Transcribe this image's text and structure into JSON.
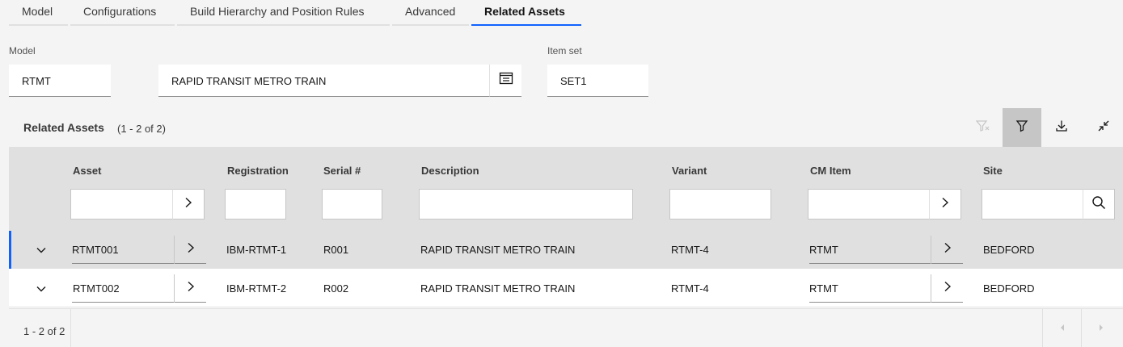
{
  "tabs": [
    {
      "label": "Model"
    },
    {
      "label": "Configurations"
    },
    {
      "label": "Build Hierarchy and Position Rules"
    },
    {
      "label": "Advanced"
    },
    {
      "label": "Related Assets"
    }
  ],
  "active_tab": "Related Assets",
  "form": {
    "model_label": "Model",
    "model_value": "RTMT",
    "model_description": "RAPID TRANSIT METRO TRAIN",
    "itemset_label": "Item set",
    "itemset_value": "SET1"
  },
  "table": {
    "title": "Related Assets",
    "count": "(1 - 2 of 2)",
    "columns": [
      "Asset",
      "Registration",
      "Serial #",
      "Description",
      "Variant",
      "CM Item",
      "Site"
    ],
    "rows": [
      {
        "asset": "RTMT001",
        "registration": "IBM-RTMT-1",
        "serial": "R001",
        "description": "RAPID TRANSIT METRO TRAIN",
        "variant": "RTMT-4",
        "cm_item": "RTMT",
        "site": "BEDFORD",
        "selected": true
      },
      {
        "asset": "RTMT002",
        "registration": "IBM-RTMT-2",
        "serial": "R002",
        "description": "RAPID TRANSIT METRO TRAIN",
        "variant": "RTMT-4",
        "cm_item": "RTMT",
        "site": "BEDFORD",
        "selected": false
      }
    ],
    "footer_text": "1 - 2 of 2"
  },
  "colors": {
    "accent": "#0f62fe",
    "header_bg": "#e0e0e0",
    "page_bg": "#f4f4f4"
  },
  "icons": [
    "lookup-icon",
    "clear-filter-icon",
    "filter-icon",
    "download-icon",
    "collapse-icon",
    "chevron-right-icon",
    "chevron-down-icon",
    "search-icon",
    "page-prev-icon",
    "page-next-icon"
  ]
}
